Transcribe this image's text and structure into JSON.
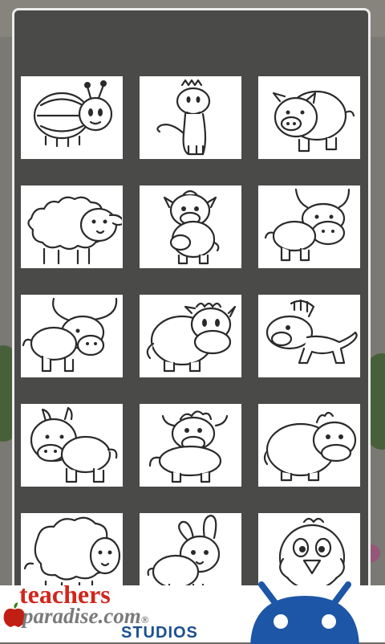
{
  "dialog": {
    "thumbnails": [
      {
        "icon": "ladybug-icon"
      },
      {
        "icon": "giraffe-icon"
      },
      {
        "icon": "pig-icon"
      },
      {
        "icon": "sheep-icon"
      },
      {
        "icon": "cow-icon"
      },
      {
        "icon": "bull-icon"
      },
      {
        "icon": "buffalo-icon"
      },
      {
        "icon": "hippo-icon"
      },
      {
        "icon": "zebra-icon"
      },
      {
        "icon": "donkey-icon"
      },
      {
        "icon": "ox-icon"
      },
      {
        "icon": "rhino-icon"
      },
      {
        "icon": "lamb-icon"
      },
      {
        "icon": "rabbit-icon"
      },
      {
        "icon": "bird-icon"
      }
    ]
  },
  "banner": {
    "brand_line1": "teachers",
    "brand_line2": "paradise.com",
    "brand_mark": "®",
    "brand_line3": "STUDIOS",
    "logo_icon": "android-icon",
    "apple_icon": "apple-icon",
    "colors": {
      "teachers_red": "#d0261c",
      "paradise_gray": "#7a7a7a",
      "studios_blue": "#1b4f8e",
      "android_blue": "#1d56a6"
    }
  }
}
